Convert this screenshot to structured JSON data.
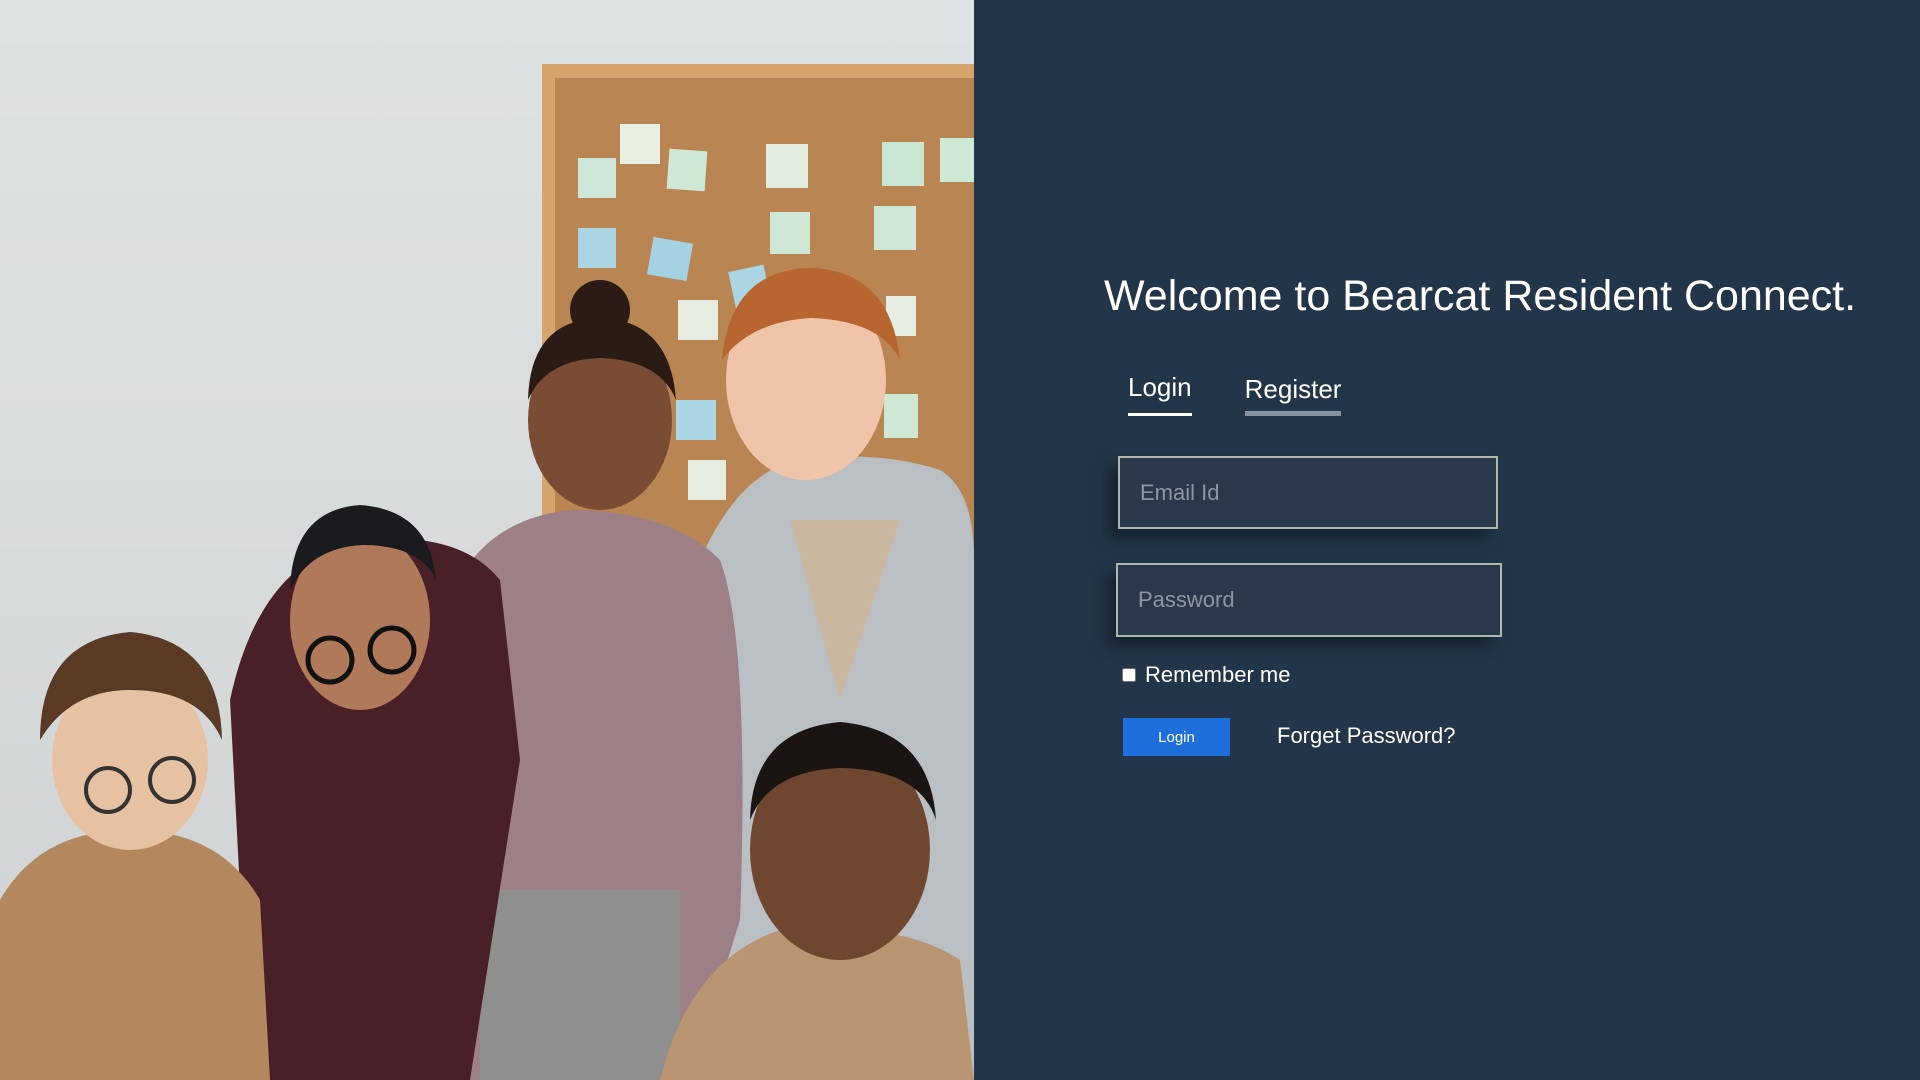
{
  "colors": {
    "panel_background": "#233649",
    "field_background": "#29394b",
    "field_border": "#aeb8a6",
    "button_blue": "#1e6fdc",
    "inactive_tab_underline": "#8793a0",
    "text": "#ffffff"
  },
  "hero_image": {
    "description_icon": "team-photo-image"
  },
  "login": {
    "title": "Welcome to Bearcat Resident Connect.",
    "tabs": [
      {
        "label": "Login",
        "active": true
      },
      {
        "label": "Register",
        "active": false
      }
    ],
    "email_placeholder": "Email Id",
    "password_placeholder": "Password",
    "remember_label": "Remember me",
    "remember_checked": false,
    "login_button_label": "Login",
    "forget_link_label": "Forget Password?"
  }
}
